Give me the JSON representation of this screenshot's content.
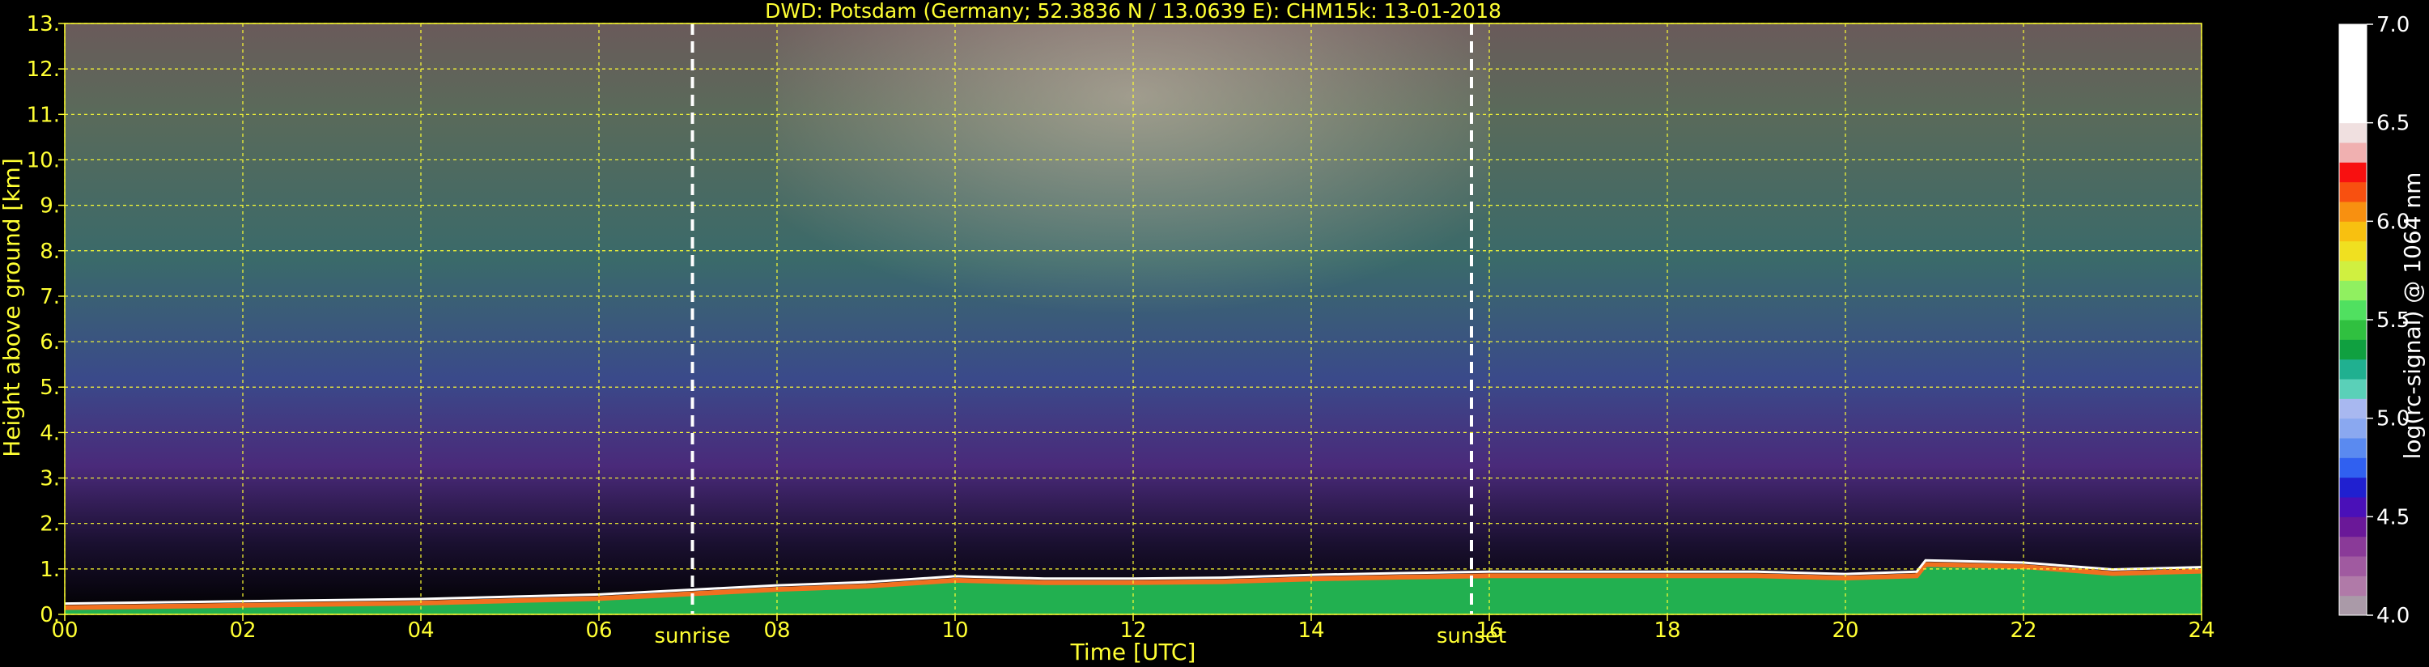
{
  "chart_data": {
    "type": "heatmap",
    "title": "DWD: Potsdam (Germany; 52.3836 N / 13.0639 E):    CHM15k: 13-01-2018",
    "xlabel": "Time [UTC]",
    "ylabel": "Height above ground [km]",
    "xlim": [
      0,
      24
    ],
    "ylim": [
      0,
      13
    ],
    "x_ticks": [
      0,
      2,
      4,
      6,
      8,
      10,
      12,
      14,
      16,
      18,
      20,
      22,
      24
    ],
    "x_tick_labels": [
      "00",
      "02",
      "04",
      "06",
      "08",
      "10",
      "12",
      "14",
      "16",
      "18",
      "20",
      "22",
      "24"
    ],
    "y_ticks": [
      0,
      1,
      2,
      3,
      4,
      5,
      6,
      7,
      8,
      9,
      10,
      11,
      12,
      13
    ],
    "y_tick_labels": [
      "0.",
      "1.",
      "2.",
      "3.",
      "4.",
      "5.",
      "6.",
      "7.",
      "8.",
      "9.",
      "10.",
      "11.",
      "12.",
      "13."
    ],
    "grid": true,
    "grid_color": "#ffff33",
    "events": [
      {
        "name": "sunrise",
        "time": 7.05
      },
      {
        "name": "sunset",
        "time": 15.8
      }
    ],
    "boundary_layer_height_km": [
      [
        0,
        0.15
      ],
      [
        2,
        0.2
      ],
      [
        4,
        0.25
      ],
      [
        6,
        0.35
      ],
      [
        7,
        0.45
      ],
      [
        8,
        0.55
      ],
      [
        9,
        0.62
      ],
      [
        10,
        0.75
      ],
      [
        11,
        0.7
      ],
      [
        12,
        0.7
      ],
      [
        13,
        0.72
      ],
      [
        14,
        0.78
      ],
      [
        15,
        0.82
      ],
      [
        16,
        0.85
      ],
      [
        17,
        0.85
      ],
      [
        18,
        0.85
      ],
      [
        19,
        0.85
      ],
      [
        20,
        0.8
      ],
      [
        20.8,
        0.85
      ],
      [
        20.9,
        1.1
      ],
      [
        22,
        1.05
      ],
      [
        23,
        0.9
      ],
      [
        24,
        0.95
      ]
    ],
    "colorbar": {
      "label": "log(rc-signal) @ 1064 nm",
      "range": [
        4.0,
        7.0
      ],
      "ticks": [
        4.0,
        4.5,
        5.0,
        5.5,
        6.0,
        6.5,
        7.0
      ],
      "tick_labels": [
        "4.0",
        "4.5",
        "5.0",
        "5.5",
        "6.0",
        "6.5",
        "7.0"
      ],
      "colors": [
        "#aa9aa8",
        "#b07aa8",
        "#a05aa0",
        "#8a3a98",
        "#6a1898",
        "#4a10b8",
        "#2020d0",
        "#3060f0",
        "#5a8af0",
        "#8aa8f0",
        "#a8b8f0",
        "#5ad0b8",
        "#20b090",
        "#10a040",
        "#30c040",
        "#50e060",
        "#90f060",
        "#d0f040",
        "#f0e020",
        "#f8c010",
        "#f89010",
        "#f85010",
        "#f81010",
        "#f0b0b0",
        "#f0e0e0",
        "#ffffff",
        "#ffffff",
        "#ffffff",
        "#ffffff",
        "#ffffff"
      ]
    }
  }
}
